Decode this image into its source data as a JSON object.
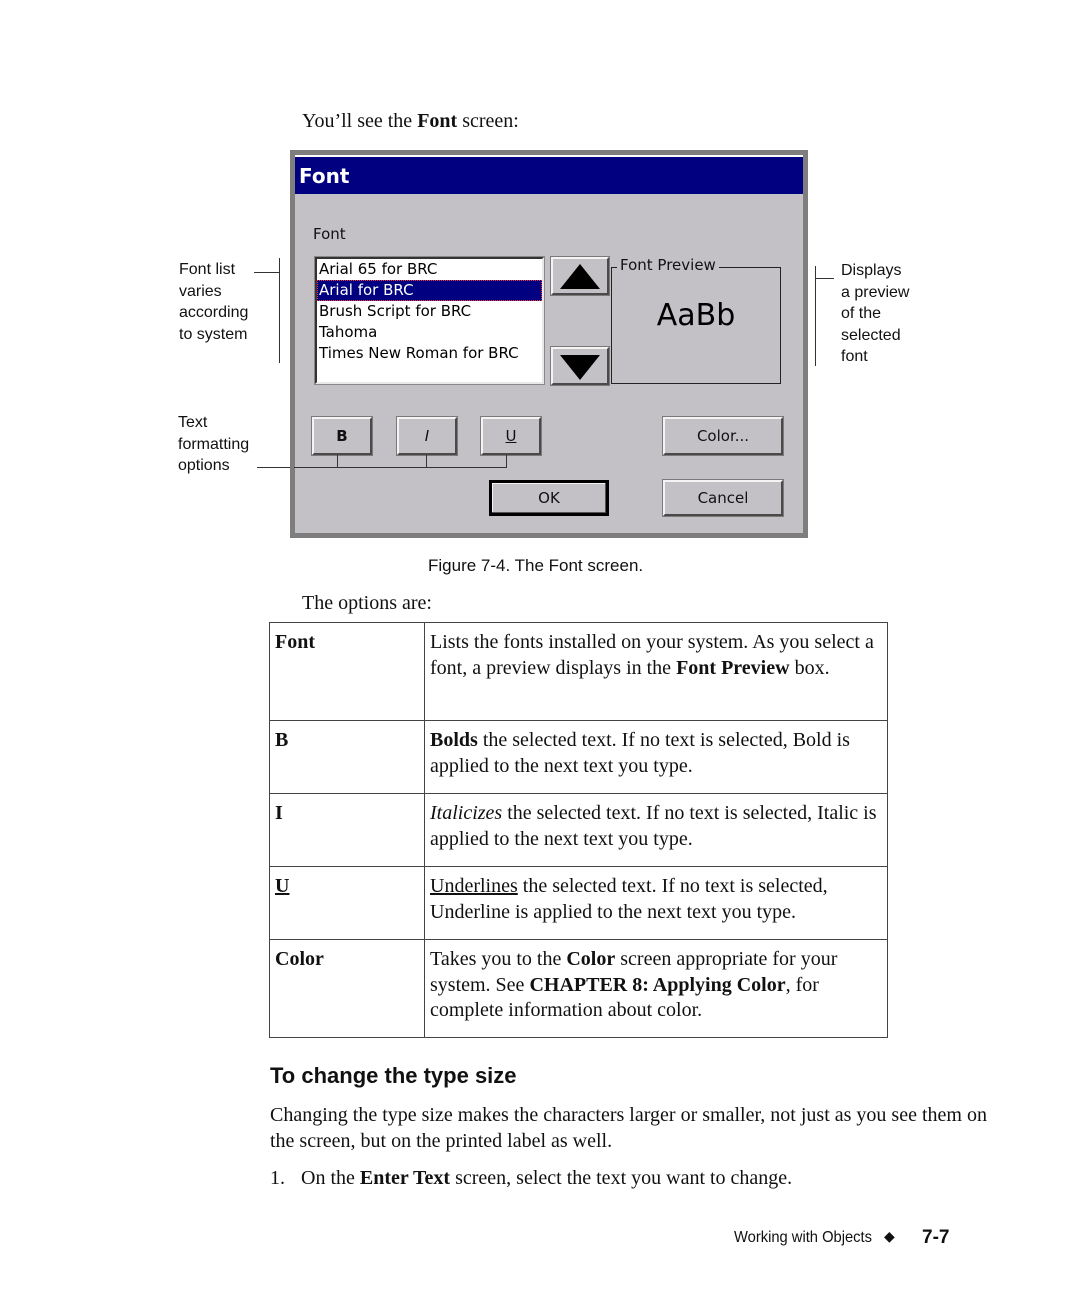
{
  "intro": {
    "prefix": "You’ll see the ",
    "bold": "Font",
    "suffix": " screen:"
  },
  "callouts": {
    "font_list": [
      "Font list",
      "varies",
      "according",
      "to system"
    ],
    "text_formatting": [
      "Text",
      "formatting",
      "options"
    ],
    "preview": [
      "Displays",
      "a preview",
      "of the",
      "selected",
      "font"
    ]
  },
  "dialog": {
    "title": "Font",
    "font_label": "Font",
    "font_list": [
      {
        "label": "Arial 65 for BRC",
        "selected": false
      },
      {
        "label": "Arial for BRC",
        "selected": true
      },
      {
        "label": "Brush Script for BRC",
        "selected": false
      },
      {
        "label": "Tahoma",
        "selected": false
      },
      {
        "label": "Times New Roman for BRC",
        "selected": false
      }
    ],
    "scroll_up_icon": "triangle-up-icon",
    "scroll_down_icon": "triangle-down-icon",
    "preview_label": "Font Preview",
    "preview_sample": "AaBb",
    "buttons": {
      "bold": "B",
      "italic": "I",
      "underline": "U",
      "color": "Color...",
      "ok": "OK",
      "cancel": "Cancel"
    },
    "colors": {
      "titlebar": "#000080",
      "face": "#c3c1c6",
      "selection": "#000080"
    }
  },
  "caption": "Figure 7-4. The Font screen.",
  "options_intro": "The options are:",
  "options_table": [
    {
      "term": "Font",
      "desc": [
        {
          "t": "Lists the fonts installed on your system. As you select a font, a preview displays in the "
        },
        {
          "t": "Font Preview",
          "b": true
        },
        {
          "t": " box."
        }
      ]
    },
    {
      "term": "B",
      "desc": [
        {
          "t": "Bolds",
          "b": true
        },
        {
          "t": " the selected text. If no text is selected, Bold is applied to the next text you type."
        }
      ]
    },
    {
      "term": "I",
      "desc": [
        {
          "t": "Italicizes",
          "i": true
        },
        {
          "t": " the selected text. If no text is selected, Italic is applied to the next text you type."
        }
      ]
    },
    {
      "term": "U",
      "term_underline": true,
      "desc": [
        {
          "t": "Underlines",
          "u": true
        },
        {
          "t": " the selected text. If no text is selected, Underline is applied to the next text you type."
        }
      ]
    },
    {
      "term": "Color",
      "desc": [
        {
          "t": "Takes you to the "
        },
        {
          "t": "Color",
          "b": true
        },
        {
          "t": " screen appropriate for your system. See "
        },
        {
          "t": "CHAPTER 8: Applying Color",
          "b": true
        },
        {
          "t": ", for complete information about color."
        }
      ]
    }
  ],
  "section": {
    "heading": "To change the type size",
    "paragraph": "Changing the type size makes the characters larger or smaller, not just as you see them on the screen, but on the printed label as well.",
    "step_1": {
      "number": "1.",
      "prefix": "On the ",
      "bold": "Enter Text",
      "suffix": " screen, select the text you want to change."
    }
  },
  "footer": {
    "section": "Working with Objects",
    "diamond": "◆",
    "page": "7-7"
  }
}
